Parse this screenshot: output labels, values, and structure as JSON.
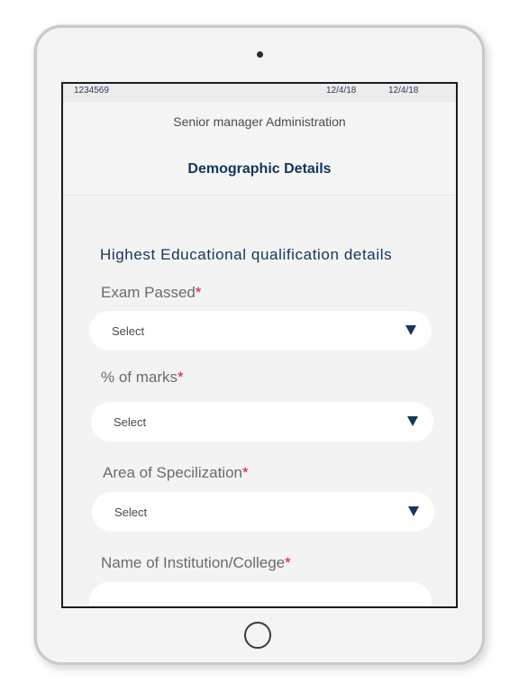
{
  "status_bar": {
    "id": "1234569",
    "date_1": "12/4/18",
    "date_2": "12/4/18"
  },
  "header": {
    "role": "Senior manager Administration",
    "title": "Demographic Details"
  },
  "form": {
    "section_heading": "Highest Educational qualification details",
    "required_marker": "*",
    "fields": [
      {
        "label": "Exam Passed",
        "value": "Select"
      },
      {
        "label": "% of marks",
        "value": "Select"
      },
      {
        "label": "Area of Specilization",
        "value": "Select"
      },
      {
        "label": "Name of Institution/College",
        "value": ""
      }
    ]
  },
  "colors": {
    "accent_navy": "#13365b",
    "required_red": "#d6163a",
    "screen_background": "#f3f3f3"
  }
}
